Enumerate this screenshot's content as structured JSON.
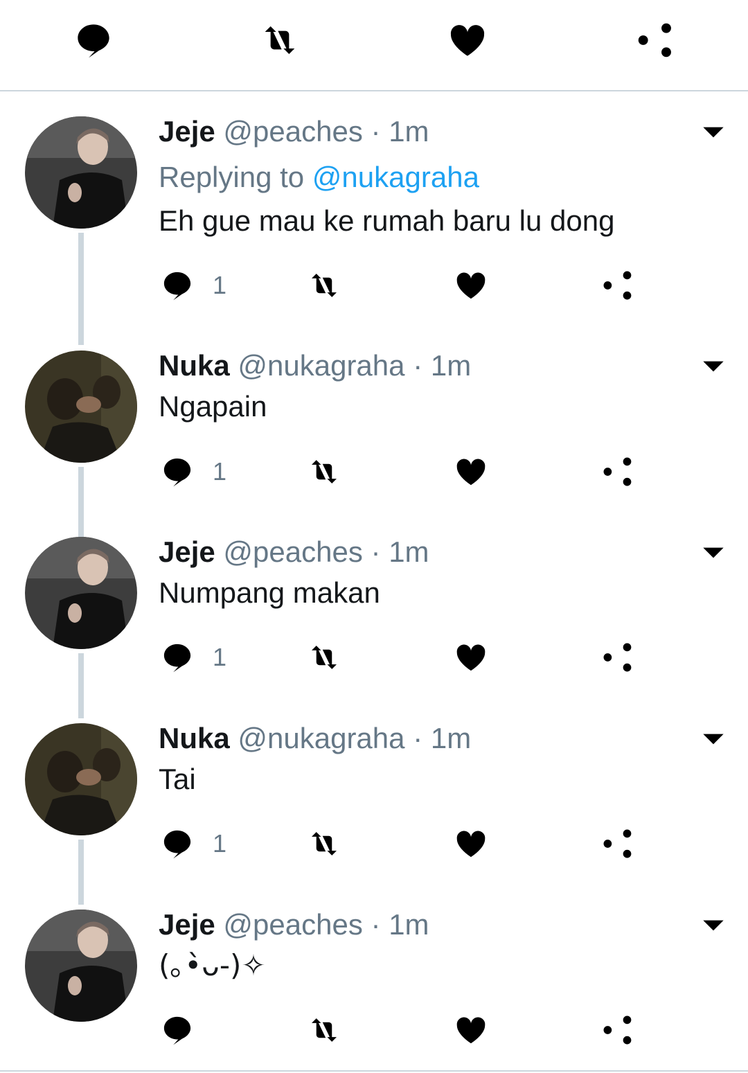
{
  "top_actions": {
    "reply_icon": "comment-icon",
    "retweet_icon": "retweet-icon",
    "like_icon": "heart-icon",
    "share_icon": "share-icon"
  },
  "tweets": [
    {
      "name": "Jeje",
      "handle": "@peaches",
      "separator": "·",
      "time": "1m",
      "replying_label": "Replying to",
      "replying_to": "@nukagraha",
      "text": "Eh gue mau ke rumah baru lu dong",
      "reply_count": "1",
      "avatar": "jeje-avatar"
    },
    {
      "name": "Nuka",
      "handle": "@nukagraha",
      "separator": "·",
      "time": "1m",
      "text": "Ngapain",
      "reply_count": "1",
      "avatar": "nuka-avatar"
    },
    {
      "name": "Jeje",
      "handle": "@peaches",
      "separator": "·",
      "time": "1m",
      "text": "Numpang makan",
      "reply_count": "1",
      "avatar": "jeje-avatar"
    },
    {
      "name": "Nuka",
      "handle": "@nukagraha",
      "separator": "·",
      "time": "1m",
      "text": "Tai",
      "reply_count": "1",
      "avatar": "nuka-avatar"
    },
    {
      "name": "Jeje",
      "handle": "@peaches",
      "separator": "·",
      "time": "1m",
      "text": "(｡•̀ᴗ-)✧",
      "reply_count": "",
      "avatar": "jeje-avatar"
    }
  ],
  "colors": {
    "text": "#14171a",
    "secondary": "#657786",
    "link": "#1da1f2",
    "divider": "#ccd6dd"
  }
}
